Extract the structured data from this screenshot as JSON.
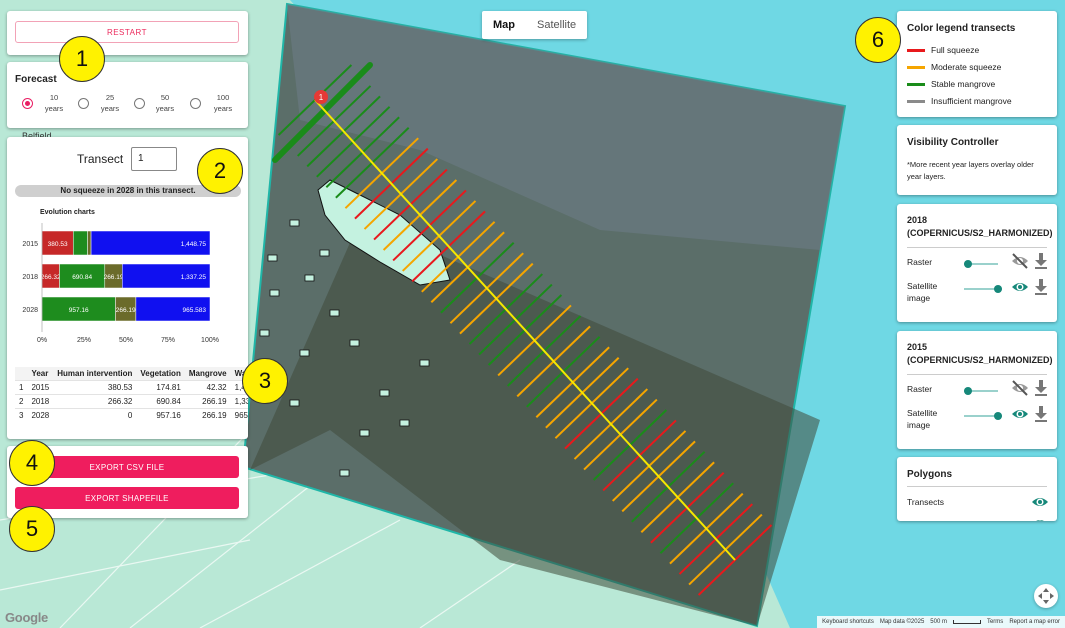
{
  "map": {
    "tabs": [
      "Map",
      "Satellite"
    ],
    "active_tab": "Map",
    "place_label": "Belfield",
    "google_logo": "Google",
    "attribution": {
      "shortcuts": "Keyboard shortcuts",
      "map_data": "Map data ©2025",
      "scale": "500 m",
      "terms": "Terms",
      "report": "Report a map error"
    },
    "marker_label": "1",
    "colors": {
      "full_squeeze": "#e8191c",
      "moderate_squeeze": "#f5a500",
      "stable_mangrove": "#1a8c1a",
      "insufficient_mangrove": "#8a8a8a",
      "shoreline": "#f5e800",
      "accent": "#ef1d5e",
      "teal": "#16887a"
    }
  },
  "controls": {
    "restart_label": "RESTART",
    "forecast": {
      "title": "Forecast",
      "options": [
        {
          "line1": "10",
          "line2": "years",
          "selected": true
        },
        {
          "line1": "25",
          "line2": "years",
          "selected": false
        },
        {
          "line1": "50",
          "line2": "years",
          "selected": false
        },
        {
          "line1": "100",
          "line2": "years",
          "selected": false
        }
      ]
    },
    "transect": {
      "label": "Transect",
      "value": "1",
      "status": "No squeeze in 2028 in this transect."
    },
    "evolution_chart_title": "Evolution charts",
    "table": {
      "headers": [
        "",
        "Year",
        "Human intervention",
        "Vegetation",
        "Mangrove",
        "Wa"
      ],
      "rows": [
        [
          "1",
          "2015",
          "380.53",
          "174.81",
          "42.32",
          "1,44"
        ],
        [
          "2",
          "2018",
          "266.32",
          "690.84",
          "266.19",
          "1,33"
        ],
        [
          "3",
          "2028",
          "0",
          "957.16",
          "266.19",
          "965"
        ]
      ]
    },
    "export_csv_label": "EXPORT CSV FILE",
    "export_shapefile_label": "EXPORT SHAPEFILE"
  },
  "chart_data": {
    "type": "bar",
    "orientation": "horizontal",
    "stacked": "percent",
    "title": "Evolution charts",
    "categories": [
      "2015",
      "2018",
      "2028"
    ],
    "xticks": [
      "0%",
      "25%",
      "50%",
      "75%",
      "100%"
    ],
    "series": [
      {
        "color": "#c62828",
        "values": [
          380.53,
          266.32,
          0
        ]
      },
      {
        "color": "#1e8c1e",
        "values": [
          174.81,
          690.84,
          957.16
        ]
      },
      {
        "color": "#6b6b2a",
        "values": [
          42.32,
          266.19,
          266.19
        ]
      },
      {
        "color": "#1010f0",
        "values": [
          1448.75,
          1337.25,
          965.583
        ]
      }
    ],
    "data_labels": [
      [
        "380.53",
        "",
        "",
        "1,448.75"
      ],
      [
        "266.32",
        "690.84",
        "266.19",
        "1,337.25"
      ],
      [
        "0",
        "957.16",
        "266.19",
        "965.583"
      ]
    ]
  },
  "legend": {
    "title": "Color legend transects",
    "items": [
      {
        "label": "Full squeeze",
        "color": "#e8191c"
      },
      {
        "label": "Moderate squeeze",
        "color": "#f5a500"
      },
      {
        "label": "Stable mangrove",
        "color": "#1a8c1a"
      },
      {
        "label": "Insufficient mangrove",
        "color": "#8a8a8a"
      }
    ]
  },
  "visibility": {
    "title": "Visibility Controller",
    "note": "*More recent year layers overlay older year layers.",
    "layers": [
      {
        "title": "2018\n(COPERNICUS/S2_HARMONIZED)",
        "raster_label": "Raster",
        "satellite_label": "Satellite\nimage",
        "raster_visible": false,
        "satellite_visible": true
      },
      {
        "title": "2015\n(COPERNICUS/S2_HARMONIZED)",
        "raster_label": "Raster",
        "satellite_label": "Satellite\nimage",
        "raster_visible": false,
        "satellite_visible": true
      }
    ],
    "polygons": {
      "title": "Polygons",
      "transects_label": "Transects"
    }
  },
  "callouts": [
    "1",
    "2",
    "3",
    "4",
    "5",
    "6"
  ]
}
